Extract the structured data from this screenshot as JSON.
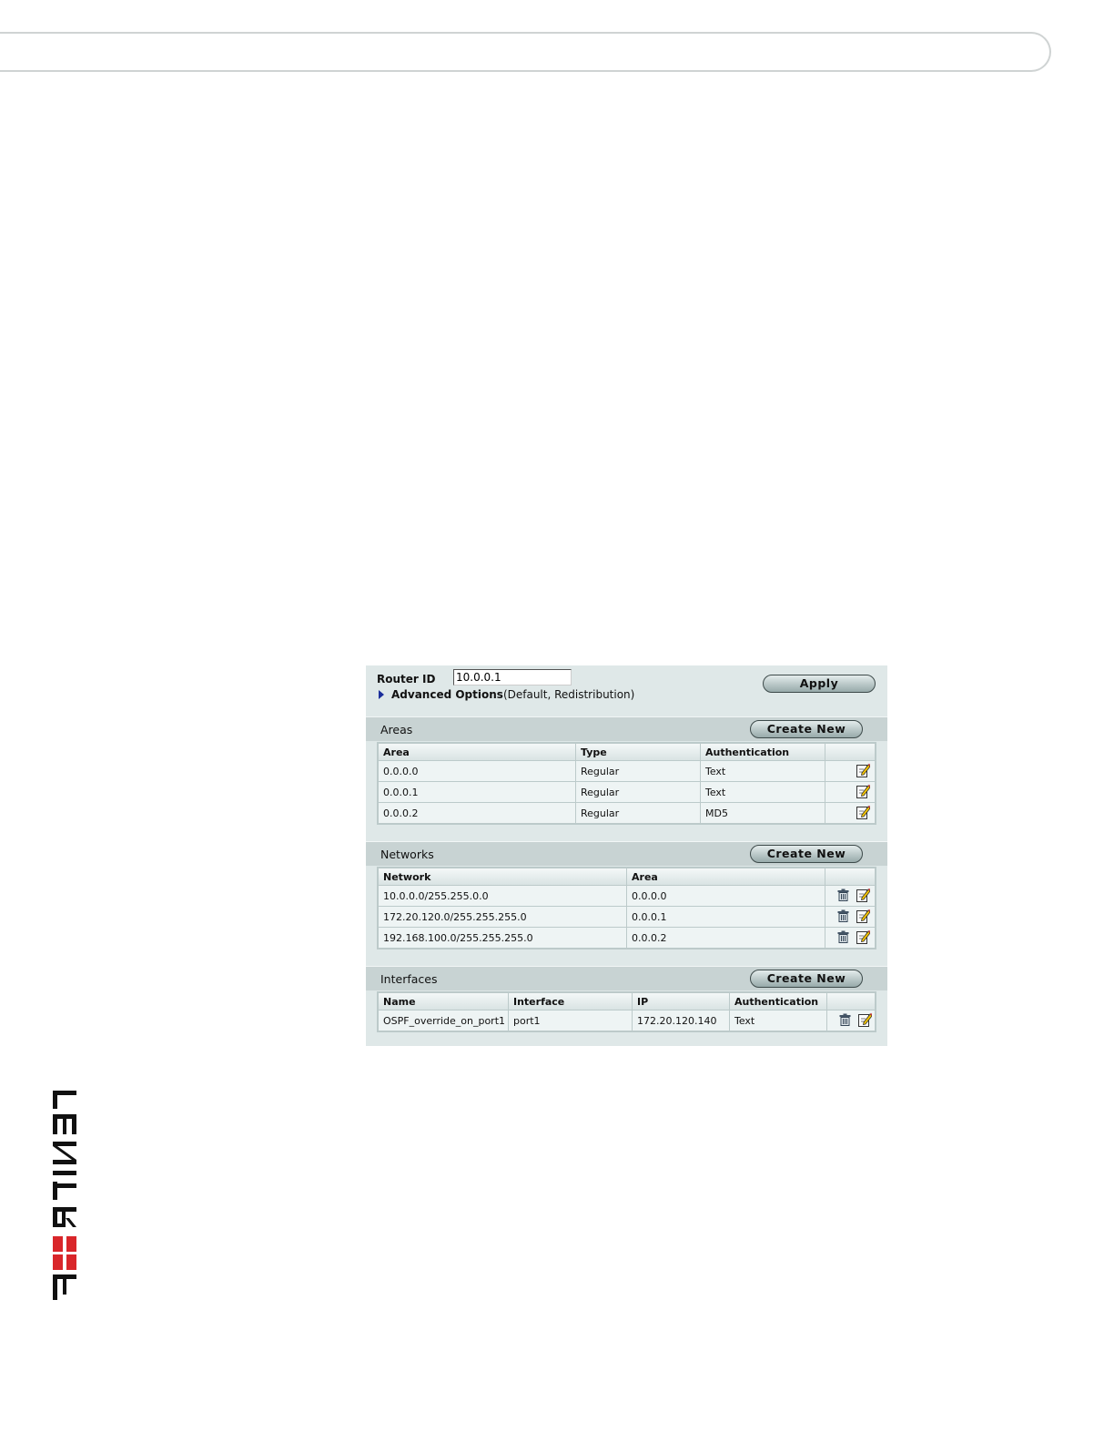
{
  "router": {
    "router_id_label": "Router ID",
    "router_id_value": "10.0.0.1",
    "advanced_label": "Advanced Options",
    "advanced_suffix": "(Default, Redistribution)",
    "apply_label": "Apply"
  },
  "areas": {
    "title": "Areas",
    "create_label": "Create New",
    "columns": [
      "Area",
      "Type",
      "Authentication"
    ],
    "rows": [
      [
        "0.0.0.0",
        "Regular",
        "Text"
      ],
      [
        "0.0.0.1",
        "Regular",
        "Text"
      ],
      [
        "0.0.0.2",
        "Regular",
        "MD5"
      ]
    ]
  },
  "networks": {
    "title": "Networks",
    "create_label": "Create New",
    "columns": [
      "Network",
      "Area"
    ],
    "rows": [
      [
        "10.0.0.0/255.255.0.0",
        "0.0.0.0"
      ],
      [
        "172.20.120.0/255.255.255.0",
        "0.0.0.1"
      ],
      [
        "192.168.100.0/255.255.255.0",
        "0.0.0.2"
      ]
    ]
  },
  "interfaces": {
    "title": "Interfaces",
    "create_label": "Create New",
    "columns": [
      "Name",
      "Interface",
      "IP",
      "Authentication"
    ],
    "rows": [
      [
        "OSPF_override_on_port1",
        "port1",
        "172.20.120.140",
        "Text"
      ]
    ]
  },
  "icons": {
    "edit": "edit-icon",
    "delete": "trash-icon",
    "expand": "expand-triangle-icon"
  },
  "colors": {
    "panel_bg": "#dfe8e8",
    "section_bg": "#c8d3d3",
    "logo_red": "#d9262a"
  }
}
